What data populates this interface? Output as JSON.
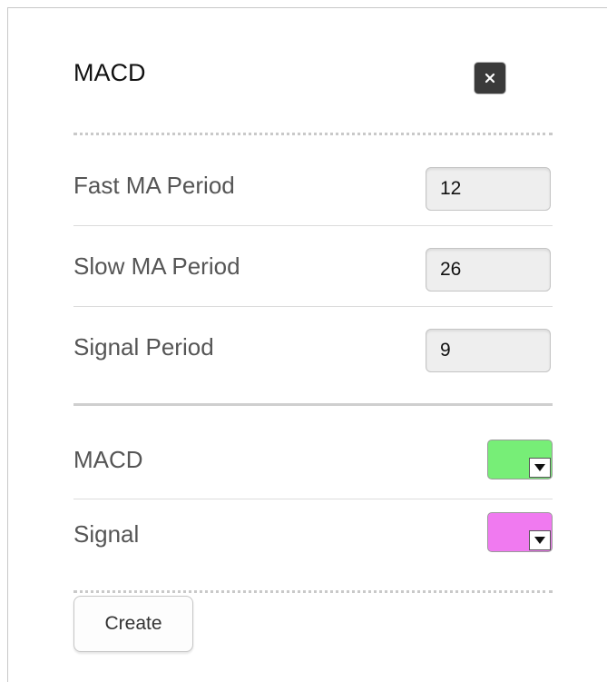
{
  "dialog": {
    "title": "MACD",
    "close_icon": "close-icon"
  },
  "periods": [
    {
      "label": "Fast MA Period",
      "value": "12"
    },
    {
      "label": "Slow MA Period",
      "value": "26"
    },
    {
      "label": "Signal Period",
      "value": "9"
    }
  ],
  "colors": [
    {
      "label": "MACD",
      "color": "#77ee77"
    },
    {
      "label": "Signal",
      "color": "#f07af0"
    }
  ],
  "actions": {
    "create_label": "Create"
  }
}
